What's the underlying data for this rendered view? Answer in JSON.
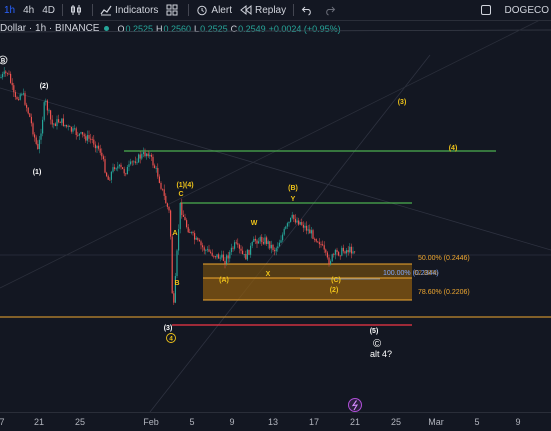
{
  "toolbar": {
    "intervals": [
      "1h",
      "4h",
      "4D"
    ],
    "active_interval": "1h",
    "indicators_label": "Indicators",
    "alert_label": "Alert",
    "replay_label": "Replay",
    "symbol_short": "DOGECO"
  },
  "legend": {
    "title": "Dollar · 1h · BINANCE",
    "open_label": "O",
    "open": "0.2525",
    "high_label": "H",
    "high": "0.2560",
    "low_label": "L",
    "low": "0.2525",
    "close_label": "C",
    "close": "0.2549",
    "change": "+0.0024 (+0.95%)",
    "up_color": "#26a69a"
  },
  "x_axis": {
    "ticks": [
      "7",
      "21",
      "25",
      "Feb",
      "5",
      "9",
      "13",
      "17",
      "21",
      "25",
      "Mar",
      "5",
      "9"
    ]
  },
  "fib_levels": {
    "level_50": "50.00% (0.2446)",
    "level_100": "100.00% (0.2344)",
    "level_100_overlap": "62.88%",
    "level_786": "78.60% (0.2206)"
  },
  "wave_labels": {
    "B_top": "B",
    "two": "(2)",
    "one": "(1)",
    "three_right": "(3)",
    "four_right": "(4)",
    "one_four": "(1)(4)",
    "C": "C",
    "A": "A",
    "B": "B",
    "three_bottom": "(3)",
    "four_circle": "4",
    "W": "W",
    "X": "X",
    "Y": "Y",
    "paren_B": "(B)",
    "paren_A": "(A)",
    "paren_C": "(C)",
    "paren_2": "(2)",
    "five": "(5)",
    "c_circle": "©",
    "alt4": "alt 4?"
  },
  "colors": {
    "background": "#131722",
    "candle_up": "#26a69a",
    "candle_down": "#ef5350",
    "wave_yellow": "#f0c419",
    "green_line": "#4caf50",
    "red_line": "#f23645",
    "orange_line": "#f0a830",
    "fib_fill": "#8a5a10"
  }
}
